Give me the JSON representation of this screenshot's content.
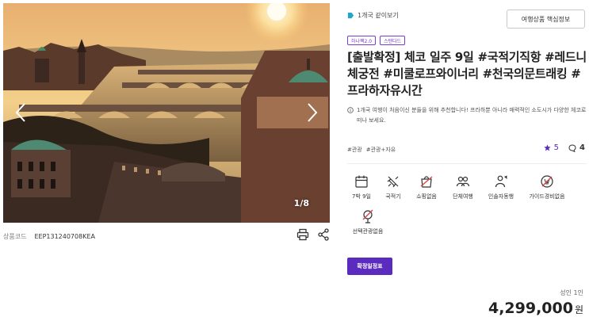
{
  "gallery": {
    "counter": "1/8"
  },
  "product": {
    "code_label": "상품코드",
    "code_value": "EEP131240708KEA"
  },
  "compare": {
    "label": "1개국 같이보기"
  },
  "key_info_button": "여행상품 핵심정보",
  "tags": [
    "하나팩2.0",
    "스탠다드"
  ],
  "title": "[출발확정] 체코 일주 9일 #국적기직항 #레드니체궁전 #미쿨로프와이너리 #천국의문트래킹 #프라하자유시간",
  "notice": "1개국 여행이 처음이신 분들을 위해 추천합니다! 프라하뿐 아니라 매력적인 소도시가 다양한 체코로 떠나 보세요.",
  "hashtags": [
    "#관광",
    "#관광+자유"
  ],
  "stats": {
    "rating": "5",
    "comments": "4"
  },
  "features": [
    {
      "label": "7박 9일",
      "icon": "calendar-icon"
    },
    {
      "label": "국적기",
      "icon": "airplane-icon"
    },
    {
      "label": "쇼핑없음",
      "icon": "shopping-bag-icon"
    },
    {
      "label": "단체여행",
      "icon": "group-icon"
    },
    {
      "label": "인솔자동행",
      "icon": "guide-person-icon"
    },
    {
      "label": "가이드경비없음",
      "icon": "no-guide-fee-icon"
    },
    {
      "label": "선택관광없음",
      "icon": "no-optional-tour-icon"
    }
  ],
  "confirm_button": "확정일정표",
  "price": {
    "label": "성인 1인",
    "value": "4,299,000",
    "unit": "원"
  },
  "colors": {
    "accent": "#5b2bc0",
    "tag": "#7a3bd2",
    "compare_icon": "#1ea7c7"
  }
}
